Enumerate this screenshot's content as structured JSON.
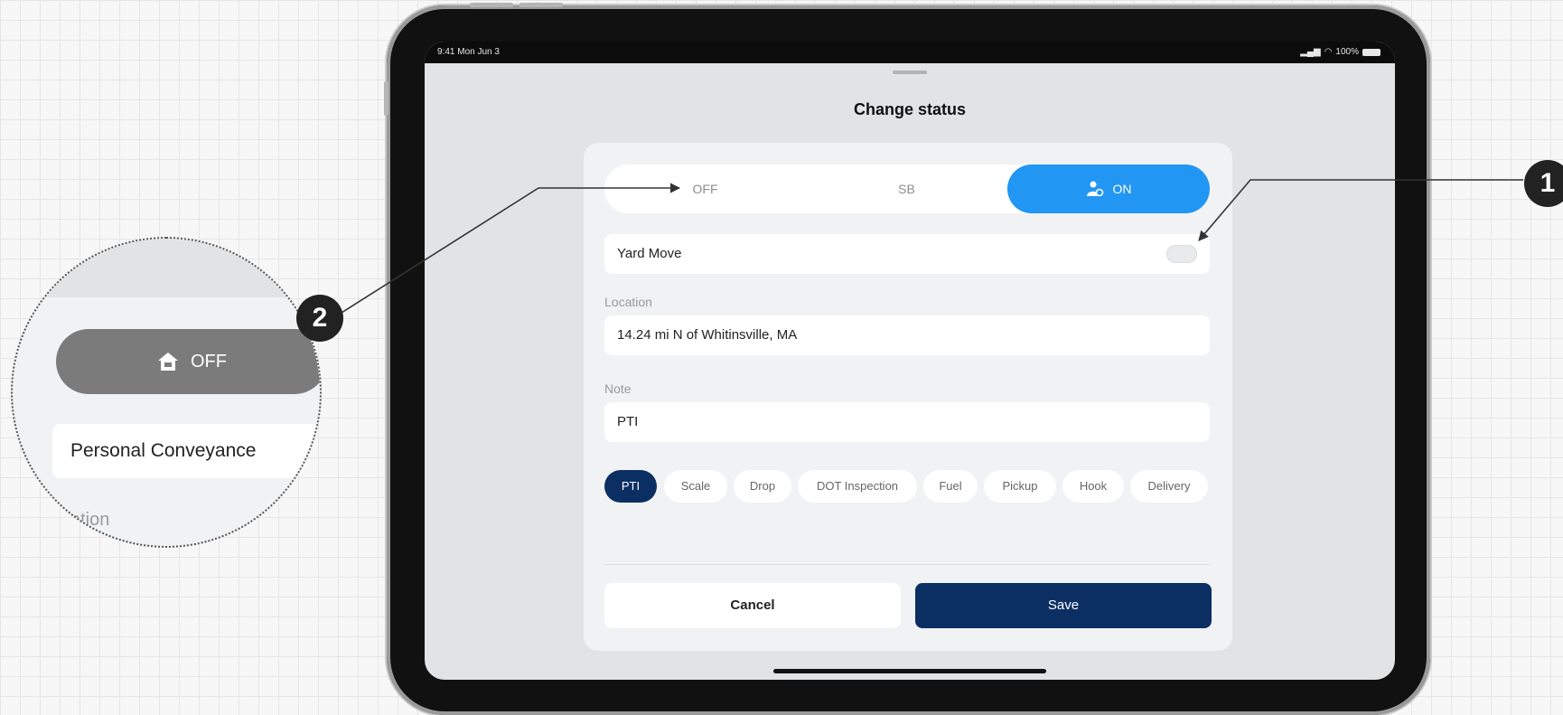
{
  "statusbar": {
    "time": "9:41 Mon Jun 3",
    "battery": "100%"
  },
  "sheet": {
    "title": "Change status"
  },
  "segments": {
    "off": "OFF",
    "sb": "SB",
    "on": "ON"
  },
  "yard_move": {
    "label": "Yard Move",
    "enabled": false
  },
  "location": {
    "label": "Location",
    "value": "14.24 mi N of Whitinsville, MA"
  },
  "note": {
    "label": "Note",
    "value": "PTI"
  },
  "chips": [
    {
      "label": "PTI",
      "active": true
    },
    {
      "label": "Scale",
      "active": false
    },
    {
      "label": "Drop",
      "active": false
    },
    {
      "label": "DOT Inspection",
      "active": false
    },
    {
      "label": "Fuel",
      "active": false
    },
    {
      "label": "Pickup",
      "active": false
    },
    {
      "label": "Hook",
      "active": false
    },
    {
      "label": "Delivery",
      "active": false
    }
  ],
  "actions": {
    "cancel": "Cancel",
    "save": "Save"
  },
  "callouts": {
    "one": "1",
    "two": "2"
  },
  "magnifier": {
    "off_label": "OFF",
    "conveyance": "Personal Conveyance",
    "partial_label": "ation"
  },
  "colors": {
    "accent_blue": "#2196f3",
    "navy": "#0c2f63",
    "off_gray": "#7b7b7b"
  }
}
